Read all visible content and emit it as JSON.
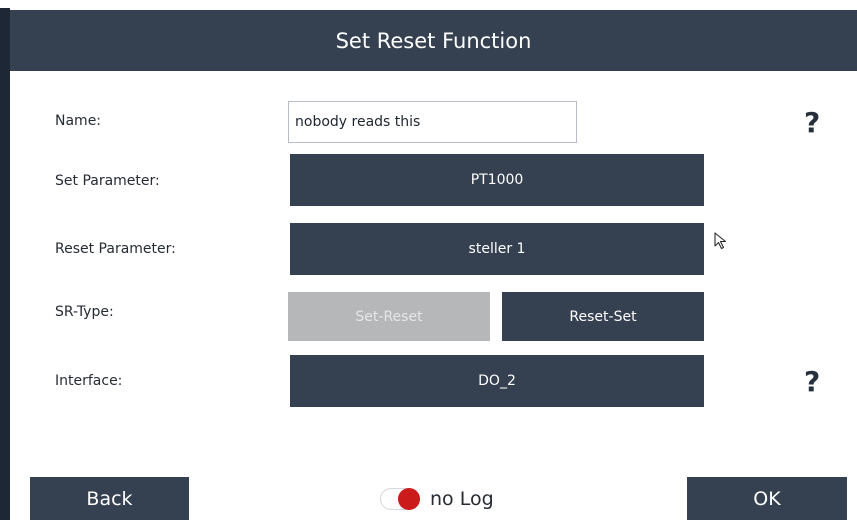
{
  "dialog": {
    "title": "Set Reset Function"
  },
  "form": {
    "name": {
      "label": "Name:",
      "value": "nobody reads this"
    },
    "set_parameter": {
      "label": "Set Parameter:",
      "value": "PT1000"
    },
    "reset_parameter": {
      "label": "Reset Parameter:",
      "value": "steller 1"
    },
    "sr_type": {
      "label": "SR-Type:",
      "options": [
        "Set-Reset",
        "Reset-Set"
      ],
      "selected": "Reset-Set"
    },
    "interface": {
      "label": "Interface:",
      "value": "DO_2"
    }
  },
  "help": {
    "glyph": "?"
  },
  "footer": {
    "back_label": "Back",
    "ok_label": "OK",
    "log_toggle": {
      "label": "no Log",
      "state": "off"
    }
  },
  "colors": {
    "header_bg": "#354051",
    "button_bg": "#354051",
    "disabled_bg": "#b5b7b9",
    "toggle_knob": "#cc1b1b"
  },
  "icons": [
    "help-icon",
    "mouse-pointer-icon",
    "toggle-switch"
  ]
}
